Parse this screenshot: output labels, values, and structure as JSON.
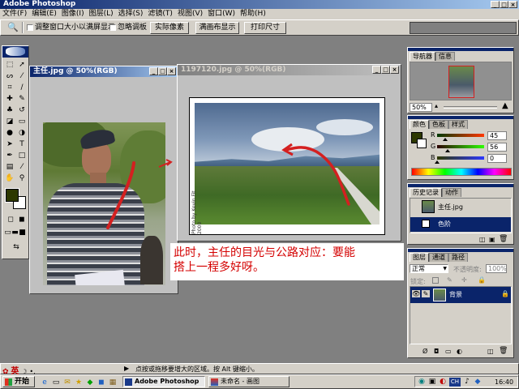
{
  "app": {
    "title": "Adobe Photoshop"
  },
  "menu": [
    "文件(F)",
    "编辑(E)",
    "图像(I)",
    "图层(L)",
    "选择(S)",
    "滤镜(T)",
    "视图(V)",
    "窗口(W)",
    "帮助(H)"
  ],
  "options": {
    "checkbox1": "调整窗口大小以满屏显示",
    "checkbox2": "忽略调板",
    "btn_actual": "实际像素",
    "btn_fit": "满画布显示",
    "btn_print": "打印尺寸"
  },
  "doc1": {
    "title": "主任.jpg @ 50%(RGB)"
  },
  "doc2": {
    "title": "1197120.jpg @ 50%(RGB)",
    "watermark": "Photo by Kevin Fit 2000"
  },
  "annotation": {
    "line1": "此时，主任的目光与公路对应：要能",
    "line2": "搭上一程多好呀。"
  },
  "navigator": {
    "tab1": "导航器",
    "tab2": "信息",
    "zoom": "50%"
  },
  "color": {
    "tab1": "颜色",
    "tab2": "色板",
    "tab3": "样式",
    "r_label": "R",
    "g_label": "G",
    "b_label": "B",
    "r": "45",
    "g": "56",
    "b": "0",
    "r_frac": 0.18,
    "g_frac": 0.22,
    "b_frac": 0.0,
    "fg": "#2d3800"
  },
  "history": {
    "tab1": "历史记录",
    "tab2": "动作",
    "snapshot": "主任.jpg",
    "step": "色阶"
  },
  "layers": {
    "tab1": "图层",
    "tab2": "通道",
    "tab3": "路径",
    "mode": "正常",
    "opacity_label": "不透明度:",
    "opacity": "100%",
    "lock_label": "锁定:",
    "layer_name": "背景"
  },
  "status": {
    "hint": "点按或拖移要增大的区域。按 Alt 键缩小。"
  },
  "taskbar": {
    "start_label": "开始",
    "ime_label": "英",
    "task1": "Adobe Photoshop",
    "task2": "未命名 - 画图",
    "clock": "16:40",
    "tray_ch": "CH"
  }
}
